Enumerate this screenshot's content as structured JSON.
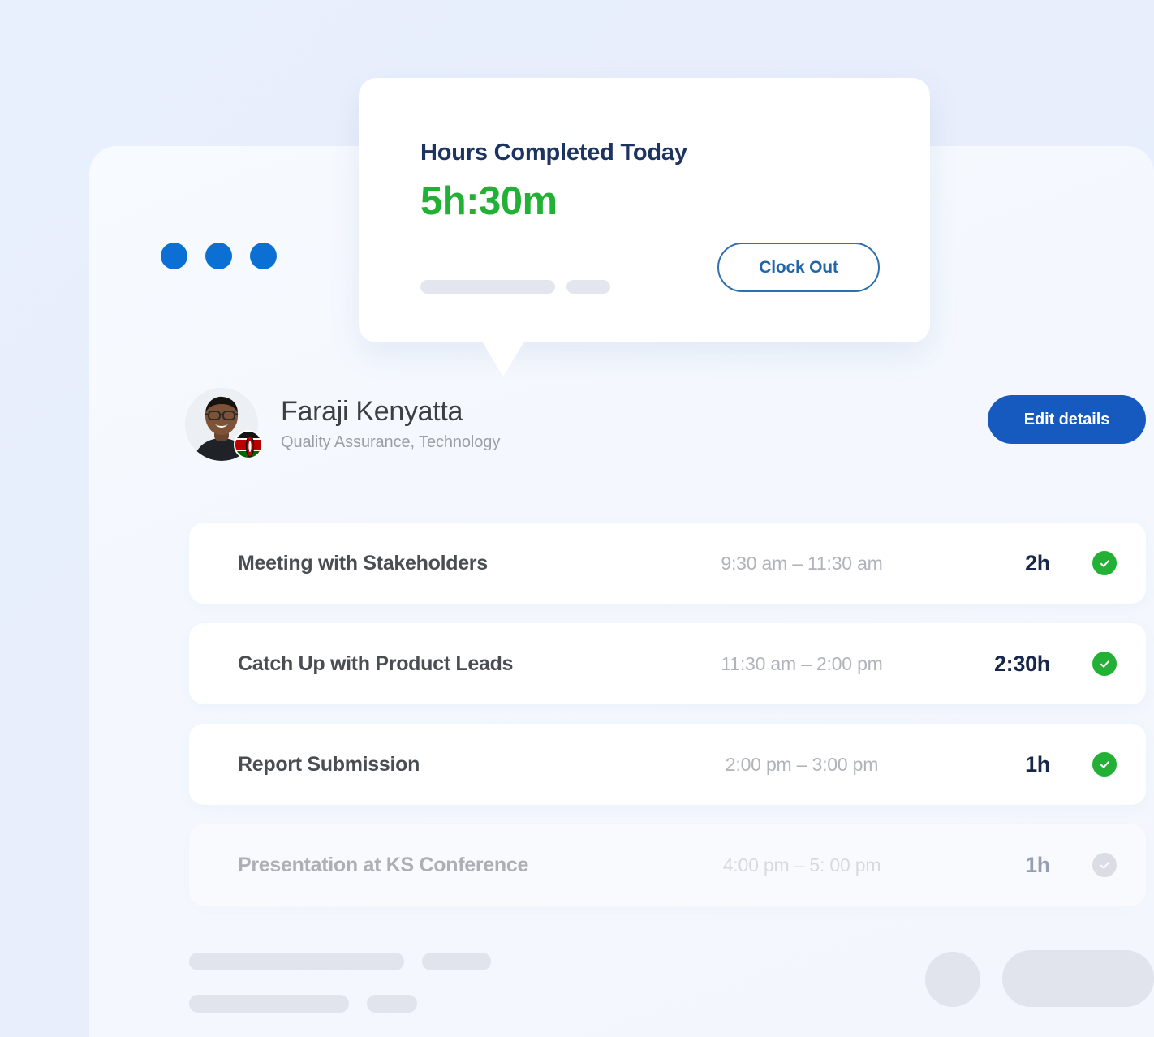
{
  "theme": {
    "page_background": "#e9f0fd",
    "panel_background": "#f6f9ff",
    "brand_blue": "#1659bf",
    "dot_blue": "#0b6fd4",
    "success_green": "#22b035",
    "heading_navy": "#1d3461",
    "muted_gray": "#b0b3b9",
    "skeleton_gray": "#e1e3ed"
  },
  "window_dots": {
    "name": "window-dots",
    "count": 3,
    "color": "#0b6fd4"
  },
  "hours_card": {
    "title": "Hours Completed Today",
    "value": "5h:30m",
    "clock_out_label": "Clock Out",
    "skeleton_bars": 2
  },
  "profile": {
    "name": "Faraji Kenyatta",
    "role": "Quality Assurance, Technology",
    "avatar_name": "user-avatar",
    "flag_name": "kenya-flag-badge",
    "edit_button_label": "Edit details"
  },
  "tasks": [
    {
      "title": "Meeting with Stakeholders",
      "time_range": "9:30 am – 11:30 am",
      "duration": "2h",
      "status": "complete"
    },
    {
      "title": "Catch Up with Product  Leads",
      "time_range": "11:30 am – 2:00 pm",
      "duration": "2:30h",
      "status": "complete"
    },
    {
      "title": "Report Submission",
      "time_range": "2:00 pm – 3:00 pm",
      "duration": "1h",
      "status": "complete"
    },
    {
      "title": "Presentation at KS Conference",
      "time_range": "4:00 pm – 5: 00 pm",
      "duration": "1h",
      "status": "pending"
    }
  ],
  "footer_placeholders": {
    "line1_bars": 2,
    "line2_bars": 2,
    "circle": 1,
    "pill": 1
  }
}
